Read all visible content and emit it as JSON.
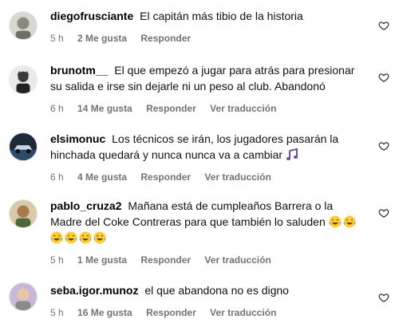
{
  "comments": [
    {
      "username": "diegofrusciante",
      "text": "El capitán más tibio de la historia",
      "time": "5 h",
      "likes": "2 Me gusta",
      "reply": "Responder",
      "translate": ""
    },
    {
      "username": "brunotm__",
      "text": "El que empezó a jugar para atrás para presionar su salida e irse sin dejarle ni un peso al club. Abandonó",
      "time": "6 h",
      "likes": "14 Me gusta",
      "reply": "Responder",
      "translate": "Ver traducción"
    },
    {
      "username": "elsimonuc",
      "text": "Los técnicos se irán, los jugadores pasarán la hinchada quedará y nunca nunca va a cambiar",
      "time": "6 h",
      "likes": "4 Me gusta",
      "reply": "Responder",
      "translate": "Ver traducción"
    },
    {
      "username": "pablo_cruza2",
      "text": "Mañana está de cumpleaños Barrera o la Madre del Coke Contreras para que también lo saluden",
      "time": "5 h",
      "likes": "1 Me gusta",
      "reply": "Responder",
      "translate": "Ver traducción"
    },
    {
      "username": "seba.igor.munoz",
      "text": "el que abandona no es digno",
      "time": "5 h",
      "likes": "16 Me gusta",
      "reply": "Responder",
      "translate": "Ver traducción"
    }
  ],
  "icons": {
    "like": "heart-outline-icon",
    "emoji_music": "musical-notes-emoji",
    "emoji_laugh": "tears-of-joy-emoji"
  },
  "colors": {
    "meta_text": "#737373",
    "primary_text": "#000000"
  }
}
